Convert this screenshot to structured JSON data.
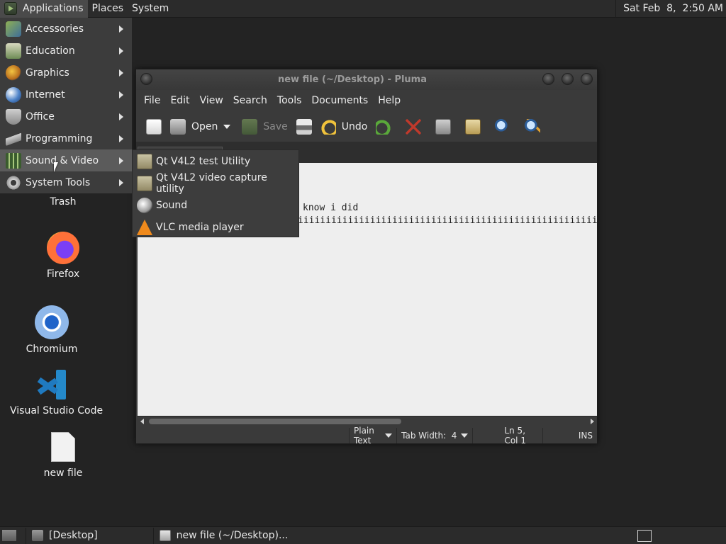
{
  "top_panel": {
    "menus": [
      "Applications",
      "Places",
      "System"
    ],
    "clock": "Sat Feb  8,  2:50 AM"
  },
  "app_menu": {
    "items": [
      {
        "label": "Accessories",
        "icon": "accessories-icon"
      },
      {
        "label": "Education",
        "icon": "education-icon"
      },
      {
        "label": "Graphics",
        "icon": "graphics-icon"
      },
      {
        "label": "Internet",
        "icon": "internet-icon"
      },
      {
        "label": "Office",
        "icon": "office-icon"
      },
      {
        "label": "Programming",
        "icon": "programming-icon"
      },
      {
        "label": "Sound & Video",
        "icon": "sound-video-icon"
      },
      {
        "label": "System Tools",
        "icon": "system-tools-icon"
      }
    ],
    "highlighted": "Sound & Video"
  },
  "sound_video_menu": {
    "items": [
      {
        "label": "Qt V4L2 test Utility",
        "icon": "folder-icon"
      },
      {
        "label": "Qt V4L2 video capture utility",
        "icon": "folder-icon"
      },
      {
        "label": "Sound",
        "icon": "sound-icon"
      },
      {
        "label": "VLC media player",
        "icon": "vlc-cone-icon"
      }
    ]
  },
  "desktop": {
    "icons": [
      {
        "label": "Trash",
        "icon": "trash-icon"
      },
      {
        "label": "Firefox",
        "icon": "firefox-icon"
      },
      {
        "label": "Chromium",
        "icon": "chromium-icon"
      },
      {
        "label": "Visual Studio Code",
        "icon": "vscode-icon"
      },
      {
        "label": "new file",
        "icon": "text-file-icon"
      }
    ]
  },
  "pluma": {
    "title": "new file (~/Desktop) - Pluma",
    "menubar": [
      "File",
      "Edit",
      "View",
      "Search",
      "Tools",
      "Documents",
      "Help"
    ],
    "toolbar": {
      "open_label": "Open",
      "save_label": "Save",
      "undo_label": "Undo"
    },
    "editor_lines": [
      "know i did",
      "iiiiiiiiiiiiiiiiiiiiiiiiiiiiiiiiiiiiiiiiiiiiiiiiiiiiiiiiiiiiiiiiiiiiiiiiiiiiiiiiiiiii"
    ],
    "status": {
      "language": "Plain Text",
      "tab_width": "Tab Width:  4",
      "position": "Ln 5, Col 1",
      "mode": "INS"
    }
  },
  "bottom_panel": {
    "tasks": [
      {
        "label": "[Desktop]",
        "icon": "folder-icon"
      },
      {
        "label": "new file (~/Desktop)...",
        "icon": "pluma-icon"
      }
    ]
  }
}
